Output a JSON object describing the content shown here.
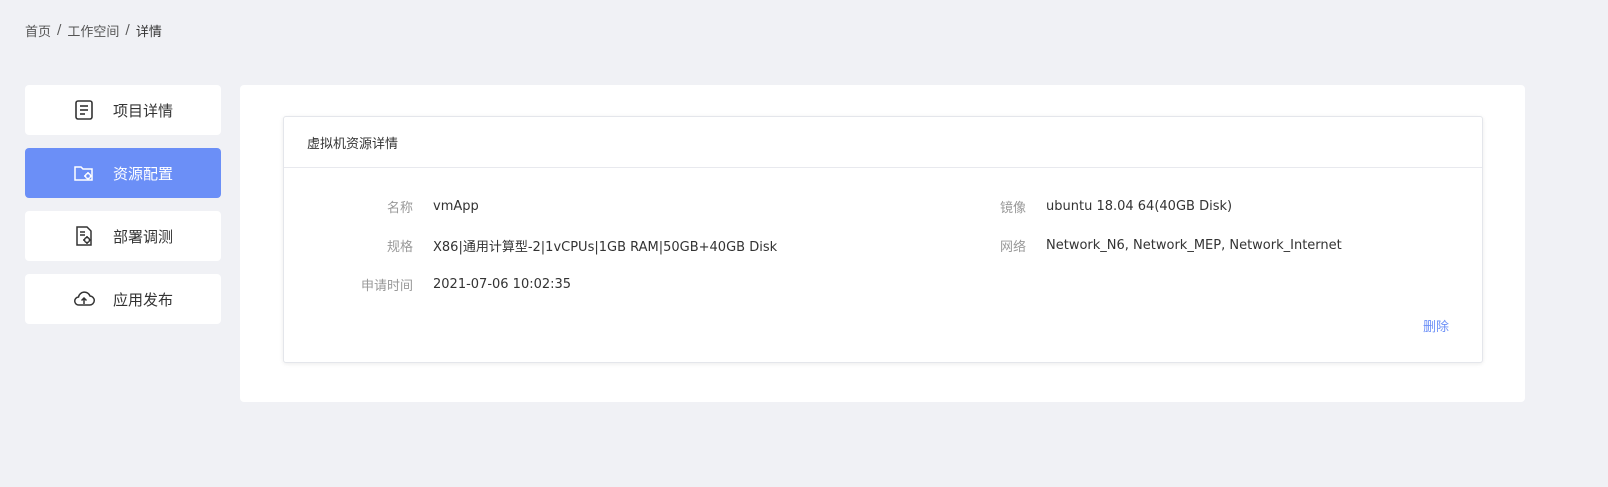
{
  "breadcrumb": {
    "home": "首页",
    "workspace": "工作空间",
    "current": "详情",
    "separator": "/"
  },
  "sidebar": {
    "items": [
      {
        "label": "项目详情",
        "icon": "document-list-icon"
      },
      {
        "label": "资源配置",
        "icon": "folder-settings-icon"
      },
      {
        "label": "部署调测",
        "icon": "file-gear-icon"
      },
      {
        "label": "应用发布",
        "icon": "cloud-upload-icon"
      }
    ]
  },
  "card": {
    "title": "虚拟机资源详情",
    "fields": {
      "name_label": "名称",
      "name_value": "vmApp",
      "spec_label": "规格",
      "spec_value": "X86|通用计算型-2|1vCPUs|1GB RAM|50GB+40GB Disk",
      "time_label": "申请时间",
      "time_value": "2021-07-06 10:02:35",
      "image_label": "镜像",
      "image_value": "ubuntu 18.04 64(40GB Disk)",
      "network_label": "网络",
      "network_value": "Network_N6, Network_MEP, Network_Internet"
    },
    "delete_label": "删除"
  },
  "colors": {
    "accent": "#6b8ff7",
    "background": "#f0f1f5"
  }
}
